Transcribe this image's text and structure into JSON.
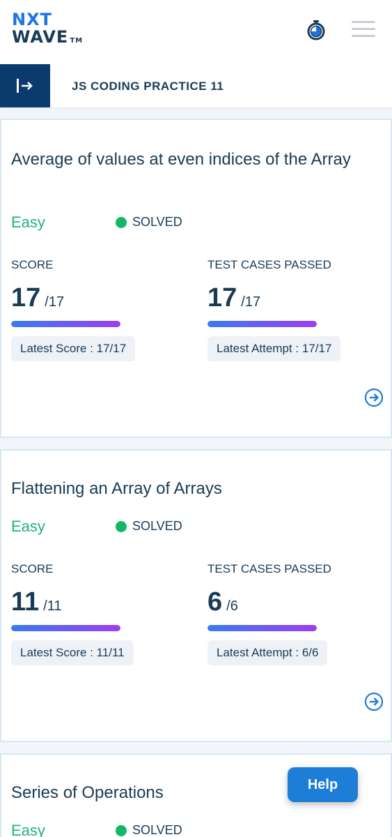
{
  "header": {
    "logo_line1": "NXT",
    "logo_line2": "WAVE",
    "logo_tm": "TM"
  },
  "subheader": {
    "title": "JS CODING PRACTICE 11"
  },
  "colors": {
    "brand_navy": "#0a3a6e",
    "text_primary": "#183b56",
    "easy_green": "#1eb37b",
    "solved_dot": "#12b76a",
    "accent_blue": "#1c7ed6"
  },
  "questions": [
    {
      "title": "Average of values at even indices of the Array",
      "difficulty": "Easy",
      "status": "SOLVED",
      "score_label": "SCORE",
      "score": "17",
      "score_total": "/17",
      "score_progress": 1.0,
      "latest_score": "Latest Score : 17/17",
      "tests_label": "TEST CASES PASSED",
      "tests": "17",
      "tests_total": "/17",
      "tests_progress": 1.0,
      "latest_attempt": "Latest Attempt : 17/17"
    },
    {
      "title": "Flattening an Array of Arrays",
      "difficulty": "Easy",
      "status": "SOLVED",
      "score_label": "SCORE",
      "score": "11",
      "score_total": "/11",
      "score_progress": 1.0,
      "latest_score": "Latest Score : 11/11",
      "tests_label": "TEST CASES PASSED",
      "tests": "6",
      "tests_total": "/6",
      "tests_progress": 1.0,
      "latest_attempt": "Latest Attempt : 6/6"
    },
    {
      "title": "Series of Operations",
      "difficulty": "Easy",
      "status": "SOLVED"
    }
  ],
  "help_label": "Help",
  "icons": {
    "timer": "stopwatch-icon",
    "menu": "hamburger-menu-icon",
    "sidebar": "sidebar-toggle-icon",
    "open": "arrow-right-circle-icon"
  }
}
